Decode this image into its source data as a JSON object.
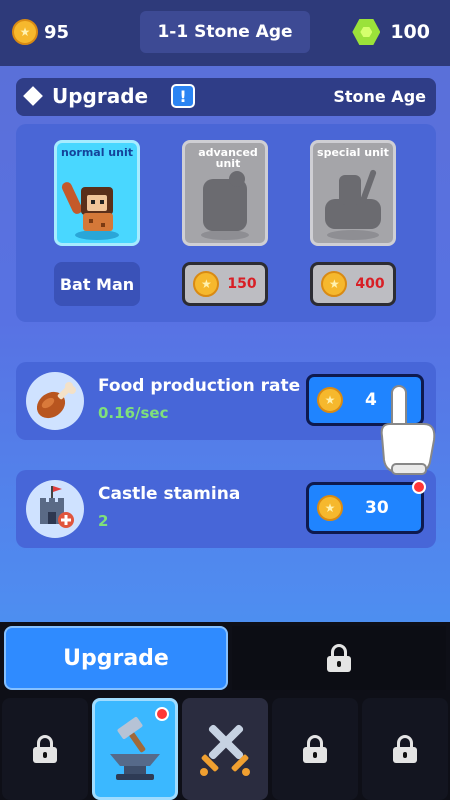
{
  "top_bar": {
    "gold": "95",
    "stage": "1-1 Stone Age",
    "gems": "100"
  },
  "upgrade_panel": {
    "title": "Upgrade",
    "alert": "!",
    "era": "Stone Age",
    "units": [
      {
        "label": "normal unit",
        "name": "Bat Man",
        "state": "owned"
      },
      {
        "label": "advanced unit",
        "price": "150",
        "state": "locked"
      },
      {
        "label": "special unit",
        "price": "400",
        "state": "locked"
      }
    ]
  },
  "stats": [
    {
      "title": "Food production rate",
      "value": "0.16/sec",
      "cost": "4",
      "icon": "chicken-leg-icon"
    },
    {
      "title": "Castle stamina",
      "value": "2",
      "cost": "30",
      "icon": "castle-icon",
      "notification": true
    }
  ],
  "bottom": {
    "upgrade_tab": "Upgrade",
    "nav": [
      "locked",
      "upgrade-anvil",
      "battle-swords",
      "locked",
      "locked"
    ]
  },
  "colors": {
    "accent": "#2f8bff",
    "gold": "#f6b82d",
    "gem": "#9be23a",
    "price_red": "#d81f26",
    "value_green": "#7fe07b"
  }
}
